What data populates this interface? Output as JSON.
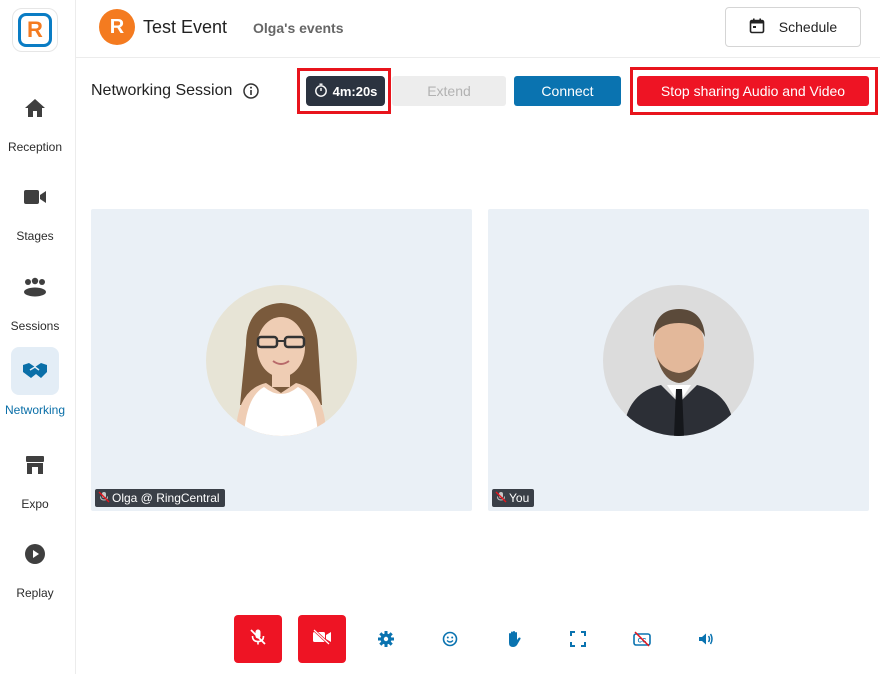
{
  "sidebar": {
    "logo_letter": "R",
    "items": [
      {
        "label": "Reception",
        "icon": "home-icon"
      },
      {
        "label": "Stages",
        "icon": "video-camera-icon"
      },
      {
        "label": "Sessions",
        "icon": "group-icon"
      },
      {
        "label": "Networking",
        "icon": "handshake-icon",
        "active": true
      },
      {
        "label": "Expo",
        "icon": "storefront-icon"
      },
      {
        "label": "Replay",
        "icon": "play-circle-icon"
      }
    ]
  },
  "header": {
    "event_avatar_letter": "R",
    "event_title": "Test Event",
    "event_subtitle": "Olga's events",
    "schedule_label": "Schedule"
  },
  "session": {
    "title": "Networking Session",
    "timer": "4m:20s",
    "extend_label": "Extend",
    "connect_label": "Connect",
    "stop_label": "Stop sharing Audio and Video"
  },
  "participants": [
    {
      "name": "Olga @ RingCentral",
      "muted": true
    },
    {
      "name": "You",
      "muted": true
    }
  ],
  "controls": [
    "mic-off-icon",
    "camera-off-icon",
    "settings-icon",
    "emoji-icon",
    "raise-hand-icon",
    "fullscreen-icon",
    "captions-off-icon",
    "speaker-icon"
  ],
  "colors": {
    "accent_blue": "#0a73b0",
    "danger_red": "#ee1424",
    "brand_orange": "#f47b20",
    "tile_bg": "#eaf0f6"
  }
}
